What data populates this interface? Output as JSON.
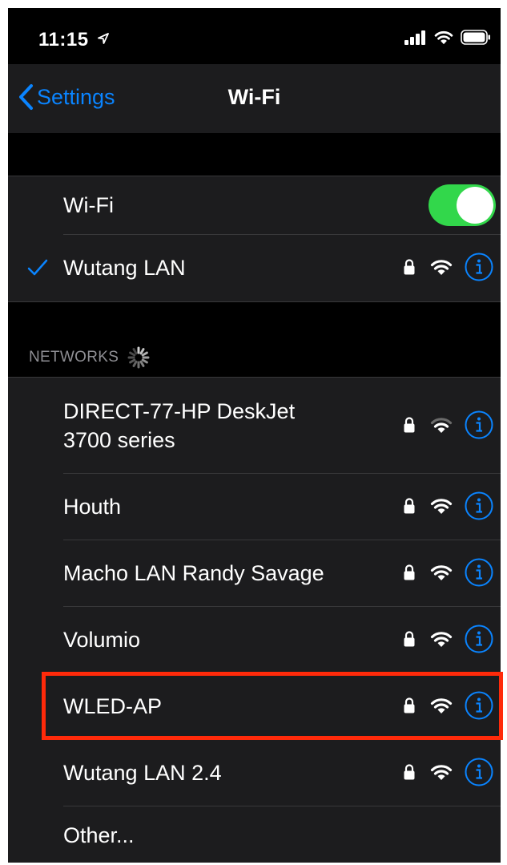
{
  "status_bar": {
    "time": "11:15"
  },
  "nav": {
    "back_label": "Settings",
    "title": "Wi-Fi"
  },
  "wifi_toggle": {
    "label": "Wi-Fi",
    "on": true
  },
  "connected": {
    "name": "Wutang LAN"
  },
  "networks_header": "NETWORKS",
  "networks": [
    {
      "name_line1": "DIRECT-77-HP DeskJet",
      "name_line2": "3700 series",
      "secured": true
    },
    {
      "name": "Houth",
      "secured": true
    },
    {
      "name": "Macho LAN Randy Savage",
      "secured": true
    },
    {
      "name": "Volumio",
      "secured": true
    },
    {
      "name": "WLED-AP",
      "secured": true,
      "highlighted": true
    },
    {
      "name": "Wutang LAN 2.4",
      "secured": true
    }
  ],
  "other_label": "Other...",
  "colors": {
    "accent": "#0a84ff",
    "toggle_on": "#32d74b",
    "highlight": "#ff2a0a",
    "background": "#000000",
    "cell": "#1c1c1e"
  },
  "icons": [
    "location-arrow-icon",
    "cellular-signal-icon",
    "wifi-icon",
    "battery-icon",
    "chevron-left-icon",
    "checkmark-icon",
    "lock-icon",
    "info-icon",
    "activity-spinner-icon"
  ]
}
